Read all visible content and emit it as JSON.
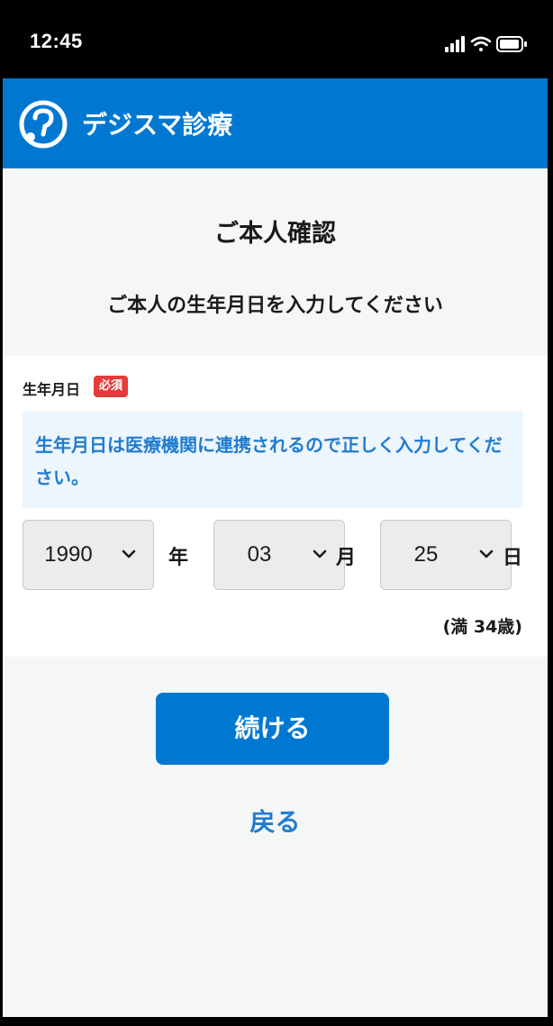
{
  "status_bar": {
    "time": "12:45"
  },
  "header": {
    "app_name": "デジスマ診療"
  },
  "page": {
    "title": "ご本人確認",
    "instruction": "ご本人の生年月日を入力してください"
  },
  "birthdate_field": {
    "label": "生年月日",
    "required_badge": "必須",
    "note": "生年月日は医療機関に連携されるので正しく入力してください。",
    "year": {
      "value": "1990",
      "unit": "年"
    },
    "month": {
      "value": "03",
      "unit": "月"
    },
    "day": {
      "value": "25",
      "unit": "日"
    },
    "age_text": "(満 34歳)"
  },
  "actions": {
    "continue_label": "続ける",
    "back_label": "戻る"
  },
  "colors": {
    "brand_blue": "#0078d2",
    "link_blue": "#1f7ccf",
    "required_red": "#e43b3b",
    "note_background": "#edf5fd"
  }
}
